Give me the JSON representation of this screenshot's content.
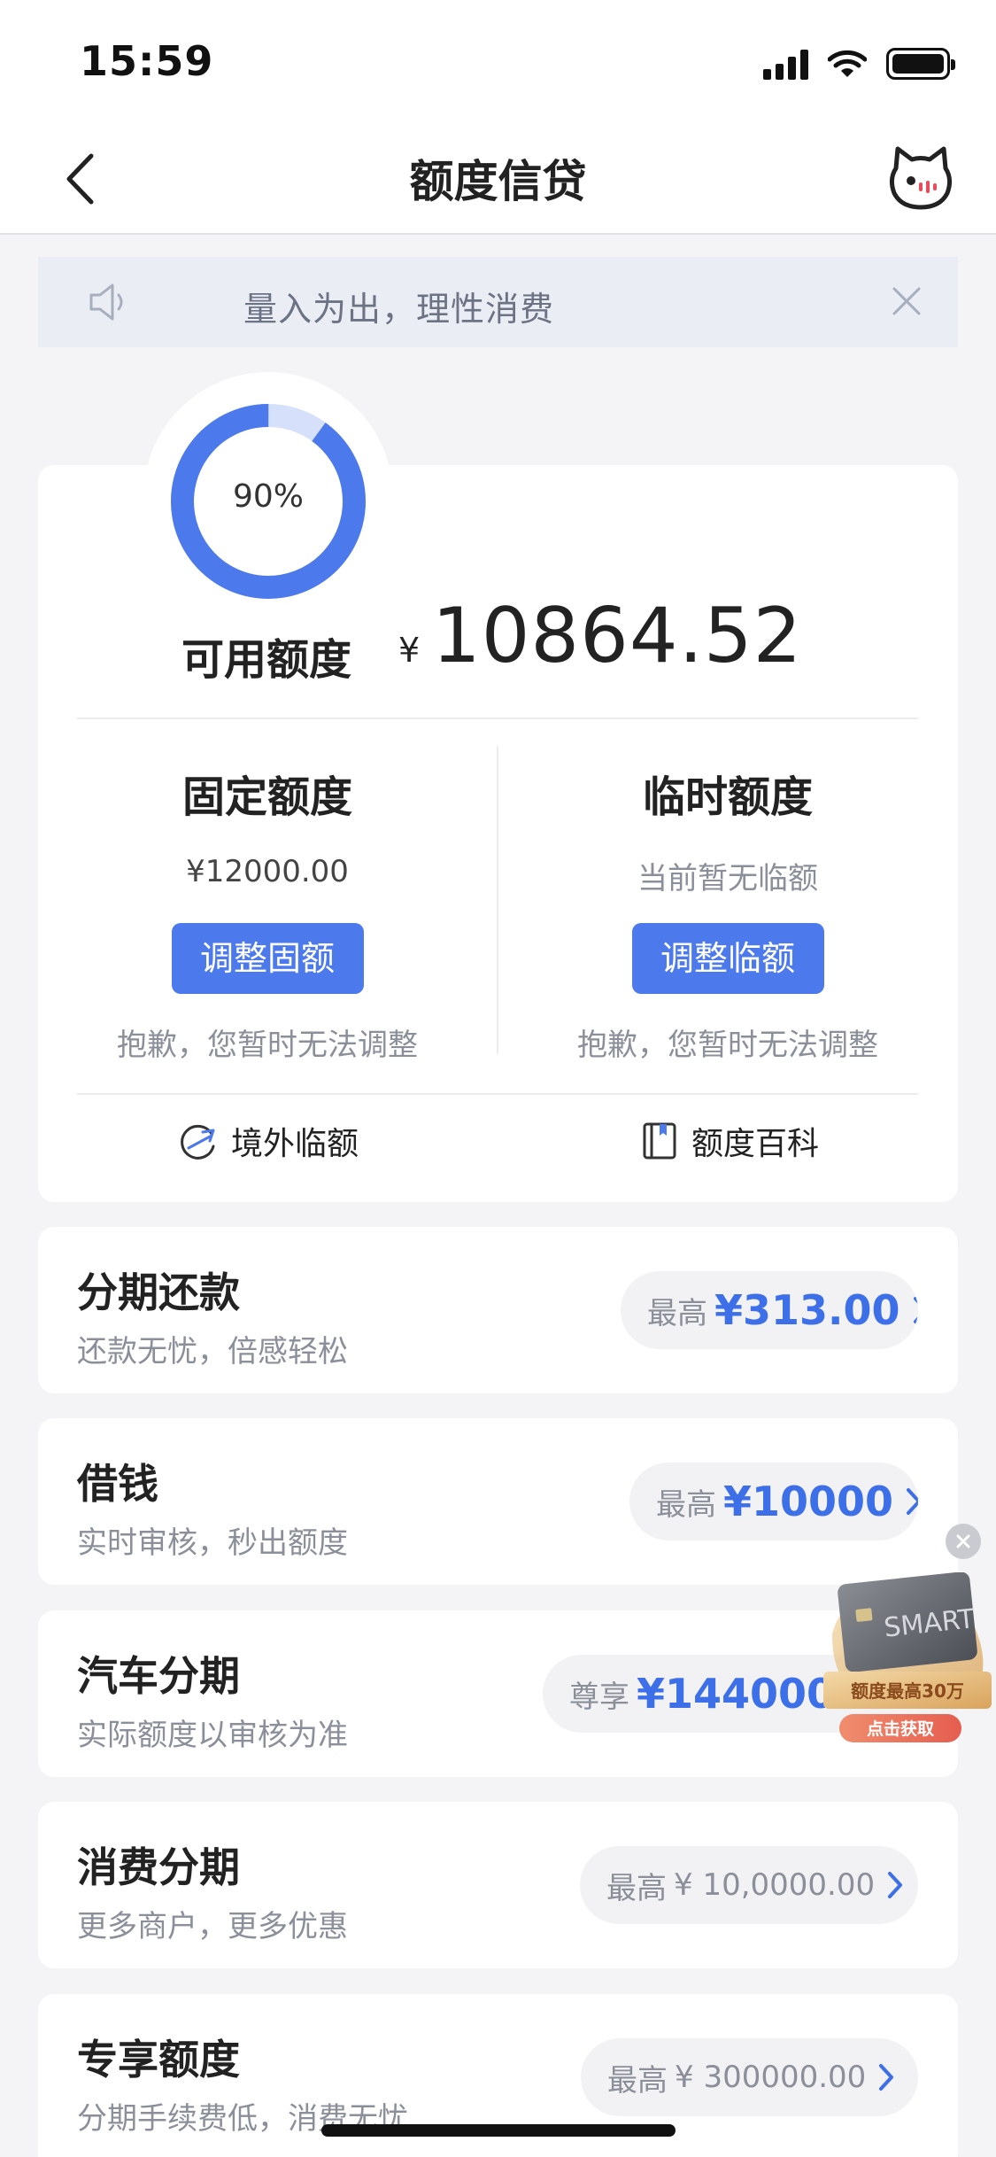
{
  "status_bar": {
    "time": "15:59"
  },
  "nav": {
    "title": "额度信贷"
  },
  "notice": {
    "text": "量入为出，理性消费"
  },
  "credit": {
    "usage_percent": 90,
    "usage_label": "90%",
    "available_label": "可用额度",
    "currency": "¥",
    "available_amount": "10864.52",
    "fixed": {
      "title": "固定额度",
      "value": "¥12000.00",
      "button": "调整固额",
      "note": "抱歉，您暂时无法调整"
    },
    "temporary": {
      "title": "临时额度",
      "value": "当前暂无临额",
      "button": "调整临额",
      "note": "抱歉，您暂时无法调整"
    },
    "links": [
      {
        "label": "境外临额"
      },
      {
        "label": "额度百科"
      }
    ]
  },
  "products": [
    {
      "title": "分期还款",
      "subtitle": "还款无忧，倍感轻松",
      "prefix": "最高",
      "amount": "¥313.00"
    },
    {
      "title": "借钱",
      "subtitle": "实时审核，秒出额度",
      "prefix": "最高",
      "amount": "¥10000"
    },
    {
      "title": "汽车分期",
      "subtitle": "实际额度以审核为准",
      "prefix": "尊享",
      "amount": "¥144000.00"
    },
    {
      "title": "消费分期",
      "subtitle": "更多商户，更多优惠",
      "prefix": "最高",
      "amount": "¥ 10,0000.00"
    },
    {
      "title": "专享额度",
      "subtitle": "分期手续费低，消费无忧",
      "prefix": "最高",
      "amount": "¥ 300000.00"
    }
  ],
  "promo": {
    "card_text": "SMART",
    "headline": "额度最高30万",
    "cta": "点击获取"
  },
  "colors": {
    "accent": "#4c79ec",
    "amount_blue": "#3c6fe8",
    "gauge_track": "#d6e0fb"
  }
}
